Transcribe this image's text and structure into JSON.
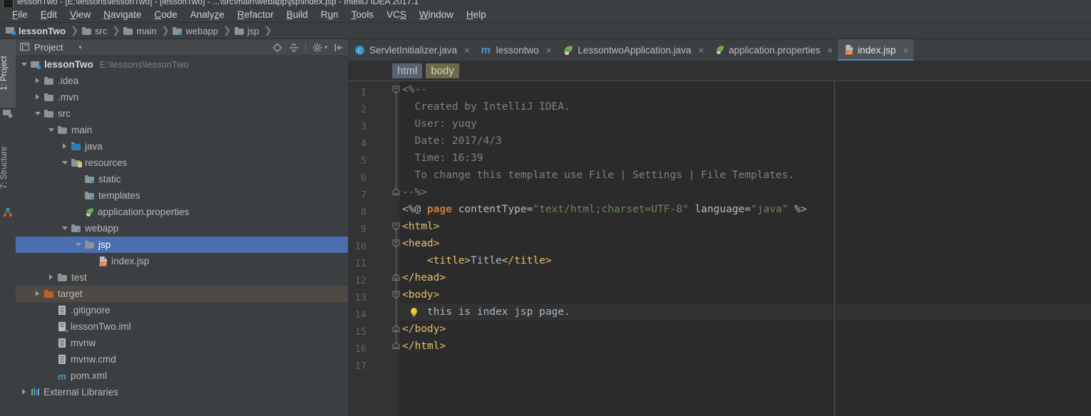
{
  "window": {
    "title": "lessonTwo - [E:\\lessons\\lessonTwo] - [lessonTwo] - ...\\src\\main\\webapp\\jsp\\index.jsp - IntelliJ IDEA 2017.1"
  },
  "menubar": {
    "items": [
      {
        "label": "File",
        "mnemonic": "F"
      },
      {
        "label": "Edit",
        "mnemonic": "E"
      },
      {
        "label": "View",
        "mnemonic": "V"
      },
      {
        "label": "Navigate",
        "mnemonic": "N"
      },
      {
        "label": "Code",
        "mnemonic": "C"
      },
      {
        "label": "Analyze",
        "mnemonic": "z"
      },
      {
        "label": "Refactor",
        "mnemonic": "R"
      },
      {
        "label": "Build",
        "mnemonic": "B"
      },
      {
        "label": "Run",
        "mnemonic": "u"
      },
      {
        "label": "Tools",
        "mnemonic": "T"
      },
      {
        "label": "VCS",
        "mnemonic": "S"
      },
      {
        "label": "Window",
        "mnemonic": "W"
      },
      {
        "label": "Help",
        "mnemonic": "H"
      }
    ]
  },
  "navbar": {
    "crumbs": [
      "lessonTwo",
      "src",
      "main",
      "webapp",
      "jsp"
    ],
    "separator": "❯"
  },
  "toolstrip": {
    "buttons": [
      {
        "label": "1: Project",
        "icon": "project-icon",
        "active": true
      },
      {
        "label": "7: Structure",
        "icon": "structure-icon",
        "active": false
      }
    ]
  },
  "project_panel": {
    "title": "Project",
    "dropdown_glyph": "▾",
    "tools": [
      {
        "name": "locate-icon",
        "title": "Select Opened File"
      },
      {
        "name": "collapse-all-icon",
        "title": "Collapse All"
      },
      {
        "name": "settings-gear-icon",
        "title": "Settings"
      },
      {
        "name": "hide-panel-icon",
        "title": "Hide"
      }
    ],
    "tree": [
      {
        "label": "lessonTwo",
        "path": "E:\\lessons\\lessonTwo",
        "indent": 0,
        "twisty": "down",
        "icon": "module-icon",
        "state": "root"
      },
      {
        "label": ".idea",
        "indent": 1,
        "twisty": "right",
        "icon": "folder-icon"
      },
      {
        "label": ".mvn",
        "indent": 1,
        "twisty": "right",
        "icon": "folder-icon"
      },
      {
        "label": "src",
        "indent": 1,
        "twisty": "down",
        "icon": "folder-icon"
      },
      {
        "label": "main",
        "indent": 2,
        "twisty": "down",
        "icon": "folder-icon"
      },
      {
        "label": "java",
        "indent": 3,
        "twisty": "right",
        "icon": "source-folder-icon"
      },
      {
        "label": "resources",
        "indent": 3,
        "twisty": "down",
        "icon": "resources-folder-icon"
      },
      {
        "label": "static",
        "indent": 4,
        "twisty": "none",
        "icon": "folder-blue-icon"
      },
      {
        "label": "templates",
        "indent": 4,
        "twisty": "none",
        "icon": "folder-blue-icon"
      },
      {
        "label": "application.properties",
        "indent": 4,
        "twisty": "none",
        "icon": "spring-properties-icon"
      },
      {
        "label": "webapp",
        "indent": 3,
        "twisty": "down",
        "icon": "folder-blue-icon"
      },
      {
        "label": "jsp",
        "indent": 4,
        "twisty": "down",
        "icon": "folder-icon",
        "state": "selected"
      },
      {
        "label": "index.jsp",
        "indent": 5,
        "twisty": "none",
        "icon": "jsp-file-icon"
      },
      {
        "label": "test",
        "indent": 2,
        "twisty": "right",
        "icon": "folder-icon"
      },
      {
        "label": "target",
        "indent": 1,
        "twisty": "right",
        "icon": "folder-orange-icon",
        "state": "highlight"
      },
      {
        "label": ".gitignore",
        "indent": 2,
        "twisty": "none",
        "icon": "text-file-icon"
      },
      {
        "label": "lessonTwo.iml",
        "indent": 2,
        "twisty": "none",
        "icon": "iml-file-icon"
      },
      {
        "label": "mvnw",
        "indent": 2,
        "twisty": "none",
        "icon": "text-file-icon"
      },
      {
        "label": "mvnw.cmd",
        "indent": 2,
        "twisty": "none",
        "icon": "text-file-icon"
      },
      {
        "label": "pom.xml",
        "indent": 2,
        "twisty": "none",
        "icon": "maven-file-icon"
      },
      {
        "label": "External Libraries",
        "indent": 0,
        "twisty": "right",
        "icon": "libraries-icon"
      }
    ]
  },
  "editor": {
    "tabs": [
      {
        "label": "ServletInitializer.java",
        "icon": "java-class-icon",
        "active": false,
        "close": "×"
      },
      {
        "label": "lessontwo",
        "icon": "maven-module-icon",
        "active": false,
        "close": "×"
      },
      {
        "label": "LessontwoApplication.java",
        "icon": "spring-class-icon",
        "active": false,
        "close": "×"
      },
      {
        "label": "application.properties",
        "icon": "spring-properties-icon",
        "active": false,
        "close": "×"
      },
      {
        "label": "index.jsp",
        "icon": "jsp-file-icon",
        "active": true,
        "close": "×"
      }
    ],
    "breadcrumbs": [
      {
        "label": "html",
        "style": "html"
      },
      {
        "label": "body",
        "style": "body"
      }
    ],
    "line_numbers": [
      1,
      2,
      3,
      4,
      5,
      6,
      7,
      8,
      9,
      10,
      11,
      12,
      13,
      14,
      15,
      16,
      17
    ],
    "caret_line": 14,
    "fold_lines": [
      1,
      7,
      9,
      10,
      12,
      13,
      15,
      16
    ],
    "lines": [
      {
        "n": 1,
        "tokens": [
          {
            "t": "<%--",
            "c": "cmt"
          }
        ]
      },
      {
        "n": 2,
        "tokens": [
          {
            "t": "  Created by IntelliJ IDEA.",
            "c": "cmt"
          }
        ]
      },
      {
        "n": 3,
        "tokens": [
          {
            "t": "  User: yuqy",
            "c": "cmt"
          }
        ]
      },
      {
        "n": 4,
        "tokens": [
          {
            "t": "  Date: 2017/4/3",
            "c": "cmt"
          }
        ]
      },
      {
        "n": 5,
        "tokens": [
          {
            "t": "  Time: 16:39",
            "c": "cmt"
          }
        ]
      },
      {
        "n": 6,
        "tokens": [
          {
            "t": "  To change this template use File | Settings | File Templates.",
            "c": "cmt"
          }
        ]
      },
      {
        "n": 7,
        "tokens": [
          {
            "t": "--%>",
            "c": "cmt"
          }
        ]
      },
      {
        "n": 8,
        "tokens": [
          {
            "t": "<%@ ",
            "c": "plain"
          },
          {
            "t": "page",
            "c": "kw"
          },
          {
            "t": " contentType=",
            "c": "attr"
          },
          {
            "t": "\"text/html;charset=UTF-8\"",
            "c": "str"
          },
          {
            "t": " language=",
            "c": "attr"
          },
          {
            "t": "\"java\"",
            "c": "str"
          },
          {
            "t": " %>",
            "c": "plain"
          }
        ]
      },
      {
        "n": 9,
        "tokens": [
          {
            "t": "<html>",
            "c": "tag"
          }
        ]
      },
      {
        "n": 10,
        "tokens": [
          {
            "t": "<head>",
            "c": "tag"
          }
        ]
      },
      {
        "n": 11,
        "tokens": [
          {
            "t": "    <title>",
            "c": "tag"
          },
          {
            "t": "Title",
            "c": "txt"
          },
          {
            "t": "</title>",
            "c": "tag"
          }
        ]
      },
      {
        "n": 12,
        "tokens": [
          {
            "t": "</head>",
            "c": "tag"
          }
        ]
      },
      {
        "n": 13,
        "tokens": [
          {
            "t": "<body>",
            "c": "tag"
          }
        ]
      },
      {
        "n": 14,
        "tokens": [
          {
            "t": "    this is index jsp page.",
            "c": "txt"
          }
        ]
      },
      {
        "n": 15,
        "tokens": [
          {
            "t": "</body>",
            "c": "tag"
          }
        ]
      },
      {
        "n": 16,
        "tokens": [
          {
            "t": "</html>",
            "c": "tag"
          }
        ]
      },
      {
        "n": 17,
        "tokens": [
          {
            "t": "",
            "c": "plain"
          }
        ]
      }
    ],
    "gutter_icon": {
      "line": 14,
      "name": "intention-bulb-icon"
    }
  },
  "colors": {
    "accent_blue": "#4b6eaf",
    "tab_underline": "#4a88c7",
    "editor_bg": "#2b2b2b",
    "panel_bg": "#3c3f41",
    "gutter_bg": "#313335",
    "tag_yellow": "#e8bf6a",
    "string_green": "#6a8759",
    "keyword_orange": "#cc7832",
    "comment_gray": "#808080",
    "text_blue": "#a9b7c6",
    "target_highlight": "#4e4a43"
  }
}
